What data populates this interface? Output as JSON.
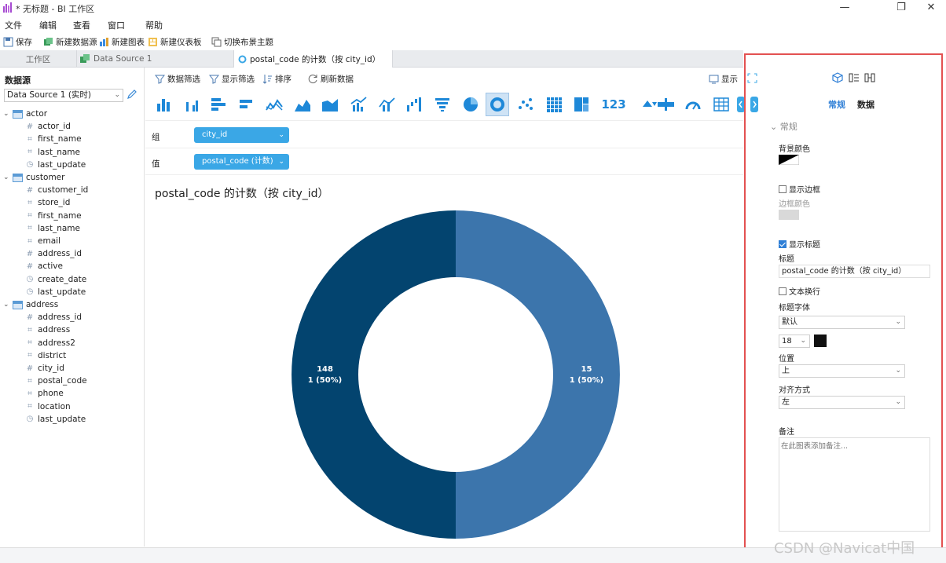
{
  "window": {
    "title": "* 无标题 - BI 工作区"
  },
  "menu": [
    "文件",
    "编辑",
    "查看",
    "窗口",
    "帮助"
  ],
  "toolbar": {
    "save": "保存",
    "new_datasource": "新建数据源",
    "new_chart": "新建图表",
    "new_dashboard": "新建仪表板",
    "switch_theme": "切换布景主题"
  },
  "tabs": [
    {
      "label": "工作区"
    },
    {
      "label": "Data Source 1"
    },
    {
      "label": "postal_code 的计数（按 city_id）"
    }
  ],
  "datasource_panel": {
    "title": "数据源",
    "selected": "Data Source 1 (实时)",
    "tables": [
      {
        "name": "actor",
        "fields": [
          {
            "name": "actor_id",
            "type": "number"
          },
          {
            "name": "first_name",
            "type": "text"
          },
          {
            "name": "last_name",
            "type": "text"
          },
          {
            "name": "last_update",
            "type": "datetime"
          }
        ]
      },
      {
        "name": "customer",
        "fields": [
          {
            "name": "customer_id",
            "type": "number"
          },
          {
            "name": "store_id",
            "type": "text"
          },
          {
            "name": "first_name",
            "type": "text"
          },
          {
            "name": "last_name",
            "type": "text"
          },
          {
            "name": "email",
            "type": "text"
          },
          {
            "name": "address_id",
            "type": "number"
          },
          {
            "name": "active",
            "type": "number"
          },
          {
            "name": "create_date",
            "type": "datetime"
          },
          {
            "name": "last_update",
            "type": "datetime"
          }
        ]
      },
      {
        "name": "address",
        "fields": [
          {
            "name": "address_id",
            "type": "number"
          },
          {
            "name": "address",
            "type": "text"
          },
          {
            "name": "address2",
            "type": "text"
          },
          {
            "name": "district",
            "type": "text"
          },
          {
            "name": "city_id",
            "type": "number"
          },
          {
            "name": "postal_code",
            "type": "text"
          },
          {
            "name": "phone",
            "type": "text"
          },
          {
            "name": "location",
            "type": "text"
          },
          {
            "name": "last_update",
            "type": "datetime"
          }
        ]
      }
    ]
  },
  "chart_toolbar": {
    "data_filter": "数据筛选",
    "display_filter": "显示筛选",
    "sort": "排序",
    "refresh": "刷新数据",
    "display": "显示"
  },
  "chart_icons": [
    "bar-chart-icon",
    "grouped-bar-icon",
    "horizontal-bar-icon",
    "horizontal-stacked-icon",
    "line-chart-icon",
    "area-chart-icon",
    "stacked-area-icon",
    "combo-chart-icon",
    "line-bar-icon",
    "waterfall-icon",
    "funnel-icon",
    "pie-icon",
    "donut-icon",
    "scatter-icon",
    "heatmap-icon",
    "treemap-icon",
    "kpi-123-icon",
    "trend-icon",
    "bullet-icon",
    "gauge-icon",
    "table-icon"
  ],
  "kpi_label": "123",
  "fields": {
    "group_label": "组",
    "group_value": "city_id",
    "value_label": "值",
    "value_value": "postal_code (计数)"
  },
  "chart_data": {
    "type": "pie",
    "title": "postal_code 的计数（按 city_id）",
    "donut": true,
    "categories": [
      "15",
      "148"
    ],
    "values": [
      1,
      1
    ],
    "percent_labels": [
      "1 (50%)",
      "1 (50%)"
    ],
    "colors": [
      "#3c75ac",
      "#03446f"
    ]
  },
  "properties": {
    "tab_general": "常规",
    "tab_data": "数据",
    "section": "常规",
    "bg_color_label": "背景颜色",
    "show_border": "显示边框",
    "show_border_checked": false,
    "border_color_label": "边框颜色",
    "show_title": "显示标题",
    "show_title_checked": true,
    "title_label": "标题",
    "title_value": "postal_code 的计数（按 city_id）",
    "wrap_text": "文本换行",
    "wrap_text_checked": false,
    "title_font_label": "标题字体",
    "font_value": "默认",
    "font_size": "18",
    "font_color": "#111111",
    "position_label": "位置",
    "position_value": "上",
    "align_label": "对齐方式",
    "align_value": "左",
    "notes_label": "备注",
    "notes_placeholder": "在此图表添加备注..."
  },
  "watermark": "CSDN @Navicat中国"
}
